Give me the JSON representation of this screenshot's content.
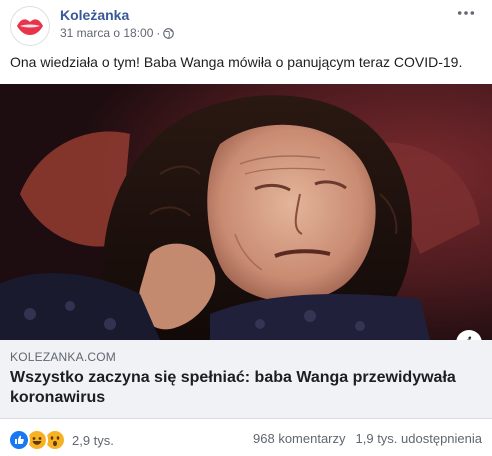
{
  "post": {
    "page_name": "Koleżanka",
    "date": "31 marca o 18:00",
    "separator": "·",
    "caption": "Ona wiedziała o tym! Baba Wanga mówiła o panującym teraz COVID-19."
  },
  "link_preview": {
    "domain": "KOLEZANKA.COM",
    "title": "Wszystko zaczyna się spełniać: baba Wanga przewidywała koronawirus"
  },
  "engagement": {
    "reactions_count": "2,9 tys.",
    "comments": "968 komentarzy",
    "shares": "1,9 tys. udostępnienia",
    "reaction_icons": [
      "like-icon",
      "love-icon",
      "wow-icon"
    ]
  },
  "icons": {
    "more": "more-horizontal-icon",
    "globe": "globe-icon",
    "info": "i"
  },
  "colors": {
    "brand_red": "#e8334a",
    "link_blue": "#385898",
    "like_blue": "#1877f2",
    "love_red": "#f33e58",
    "wow_yellow": "#f7b125"
  }
}
